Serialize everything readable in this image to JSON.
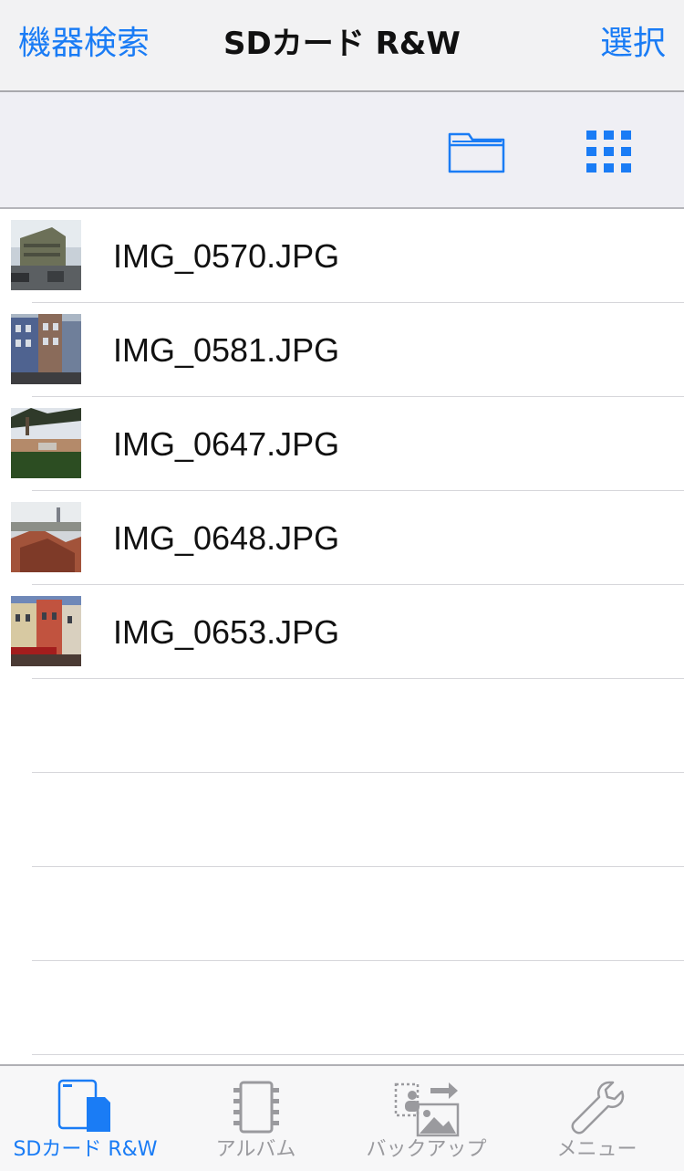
{
  "navbar": {
    "left_button": "機器検索",
    "title": "SDカード R&W",
    "right_button": "選択"
  },
  "toolbar": {
    "icons": [
      "folder-icon",
      "grid-view-icon"
    ]
  },
  "files": [
    {
      "name": "IMG_0570.JPG"
    },
    {
      "name": "IMG_0581.JPG"
    },
    {
      "name": "IMG_0647.JPG"
    },
    {
      "name": "IMG_0648.JPG"
    },
    {
      "name": "IMG_0653.JPG"
    }
  ],
  "tabs": [
    {
      "label": "SDカード R&W",
      "icon": "sd-card-icon",
      "active": true
    },
    {
      "label": "アルバム",
      "icon": "film-strip-icon",
      "active": false
    },
    {
      "label": "バックアップ",
      "icon": "backup-icon",
      "active": false
    },
    {
      "label": "メニュー",
      "icon": "wrench-icon",
      "active": false
    }
  ],
  "colors": {
    "accent": "#1a7cf5",
    "inactive": "#9a9a9e"
  }
}
